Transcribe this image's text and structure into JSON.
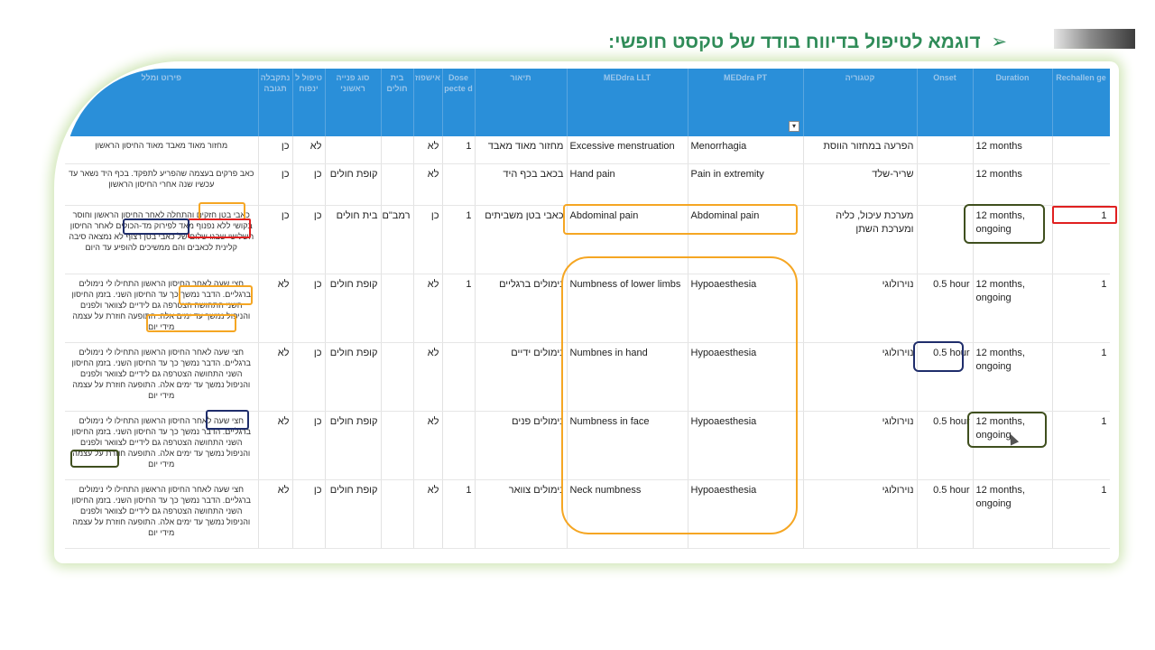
{
  "title": "דוגמא לטיפול בדיווח בודד של טקסט חופשי:",
  "headers": [
    "פירוט ומלל",
    "נתקבלה תגובה",
    "טיפול ל ינפוח",
    "סוג פנייה ראשוני",
    "בית חולים",
    "אישפוז",
    "Dose pecte d",
    "תיאור",
    "MEDdra LLT",
    "MEDdra PT",
    "קטגוריה",
    "Onset",
    "Duration",
    "Rechallen ge"
  ],
  "rows": [
    {
      "narrative": "מחזור מאוד מאבד מאוד החיסון הראשון",
      "c1": "כן",
      "c2": "לא",
      "c3": "",
      "c4": "",
      "c5": "לא",
      "dose": "1",
      "desc": "מחזור מאוד מאבד",
      "llt": "Excessive menstruation",
      "pt": "Menorrhagia",
      "cat": "הפרעה במחזור הווסת",
      "onset": "",
      "duration": "12 months",
      "rechal": ""
    },
    {
      "narrative": "כאב פרקים בעצמה שהפריע לתפקד. בכף היד נשאר עד עכשיו שנה אחרי החיסון הראשון",
      "c1": "כן",
      "c2": "כן",
      "c3": "קופת חולים",
      "c4": "",
      "c5": "לא",
      "dose": "",
      "desc": "בכאב בכף היד",
      "llt": "Hand pain",
      "pt": "Pain in extremity",
      "cat": "שריר-שלד",
      "onset": "",
      "duration": "12 months",
      "rechal": ""
    },
    {
      "narrative": "כאבי בטן חזקים והתחלה לאחר החיסון הראשון וחוסר בקושי ללא נפנוף מאד לפירוק מד-הכולים לאחר החיסון השלישי שבגו שלום של כאבי בטן רצוף לא נמצאה סיבה קלינית לכאבים והם ממשיכים להופיע עד היום",
      "c1": "כן",
      "c2": "כן",
      "c3": "בית חולים",
      "c4": "רמב\"ם",
      "c5": "כן",
      "dose": "1",
      "desc": "כאבי בטן משביתים",
      "llt": "Abdominal pain",
      "pt": "Abdominal pain",
      "cat": "מערכת עיכול, כליה ומערכת השתן",
      "onset": "",
      "duration": "12 months, ongoing",
      "rechal": "1"
    },
    {
      "narrative": "חצי שעה לאחר החיסון הראשון התחילו לי נימולים ברגליים. הדבר נמשך כך עד החיסון השני. בזמן החיסון השני התחושה הצטרפה גם לידיים לצוואר ולפנים והניפול נמשך עד ימים אלה. התופעה חוזרת על עצמה מידי יום",
      "c1": "לא",
      "c2": "כן",
      "c3": "קופת חולים",
      "c4": "",
      "c5": "לא",
      "dose": "1",
      "desc": "נימולים ברגליים",
      "llt": "Numbness of lower limbs",
      "pt": "Hypoaesthesia",
      "cat": "נוירולוגי",
      "onset": "0.5 hour",
      "duration": "12 months, ongoing",
      "rechal": "1"
    },
    {
      "narrative": "חצי שעה לאחר החיסון הראשון התחילו לי נימולים ברגליים. הדבר נמשך כך עד החיסון השני. בזמן החיסון השני התחושה הצטרפה גם לידיים לצוואר ולפנים והניפול נמשך עד ימים אלה. התופעה חוזרת על עצמה מידי יום",
      "c1": "לא",
      "c2": "כן",
      "c3": "קופת חולים",
      "c4": "",
      "c5": "לא",
      "dose": "",
      "desc": "נימולים ידיים",
      "llt": "Numbnes in hand",
      "pt": "Hypoaesthesia",
      "cat": "נוירולוגי",
      "onset": "0.5 hour",
      "duration": "12 months, ongoing",
      "rechal": "1"
    },
    {
      "narrative": "חצי שעה לאחר החיסון הראשון התחילו לי נימולים ברגליים. הדבר נמשך כך עד החיסון השני. בזמן החיסון השני התחושה הצטרפה גם לידיים לצוואר ולפנים והניפול נמשך עד ימים אלה. התופעה חוזרת על עצמה מידי יום",
      "c1": "לא",
      "c2": "כן",
      "c3": "קופת חולים",
      "c4": "",
      "c5": "לא",
      "dose": "",
      "desc": "נימולים פנים",
      "llt": "Numbness in face",
      "pt": "Hypoaesthesia",
      "cat": "נוירולוגי",
      "onset": "0.5 hour",
      "duration": "12 months, ongoing",
      "rechal": "1"
    },
    {
      "narrative": "חצי שעה לאחר החיסון הראשון התחילו לי נימולים ברגליים. הדבר נמשך כך עד החיסון השני. בזמן החיסון השני התחושה הצטרפה גם לידיים לצוואר ולפנים והניפול נמשך עד ימים אלה. התופעה חוזרת על עצמה מידי יום",
      "c1": "לא",
      "c2": "כן",
      "c3": "קופת חולים",
      "c4": "",
      "c5": "לא",
      "dose": "1",
      "desc": "נימולים צוואר",
      "llt": "Neck numbness",
      "pt": "Hypoaesthesia",
      "cat": "נוירולוגי",
      "onset": "0.5 hour",
      "duration": "12 months, ongoing",
      "rechal": "1"
    }
  ],
  "filter_glyph": "▾",
  "colors": {
    "header": "#2a8fd9",
    "title": "#2e8b57",
    "orange": "#f5a623",
    "red": "#e02020",
    "navy": "#1f2d6b",
    "olive": "#3f4f1e"
  }
}
